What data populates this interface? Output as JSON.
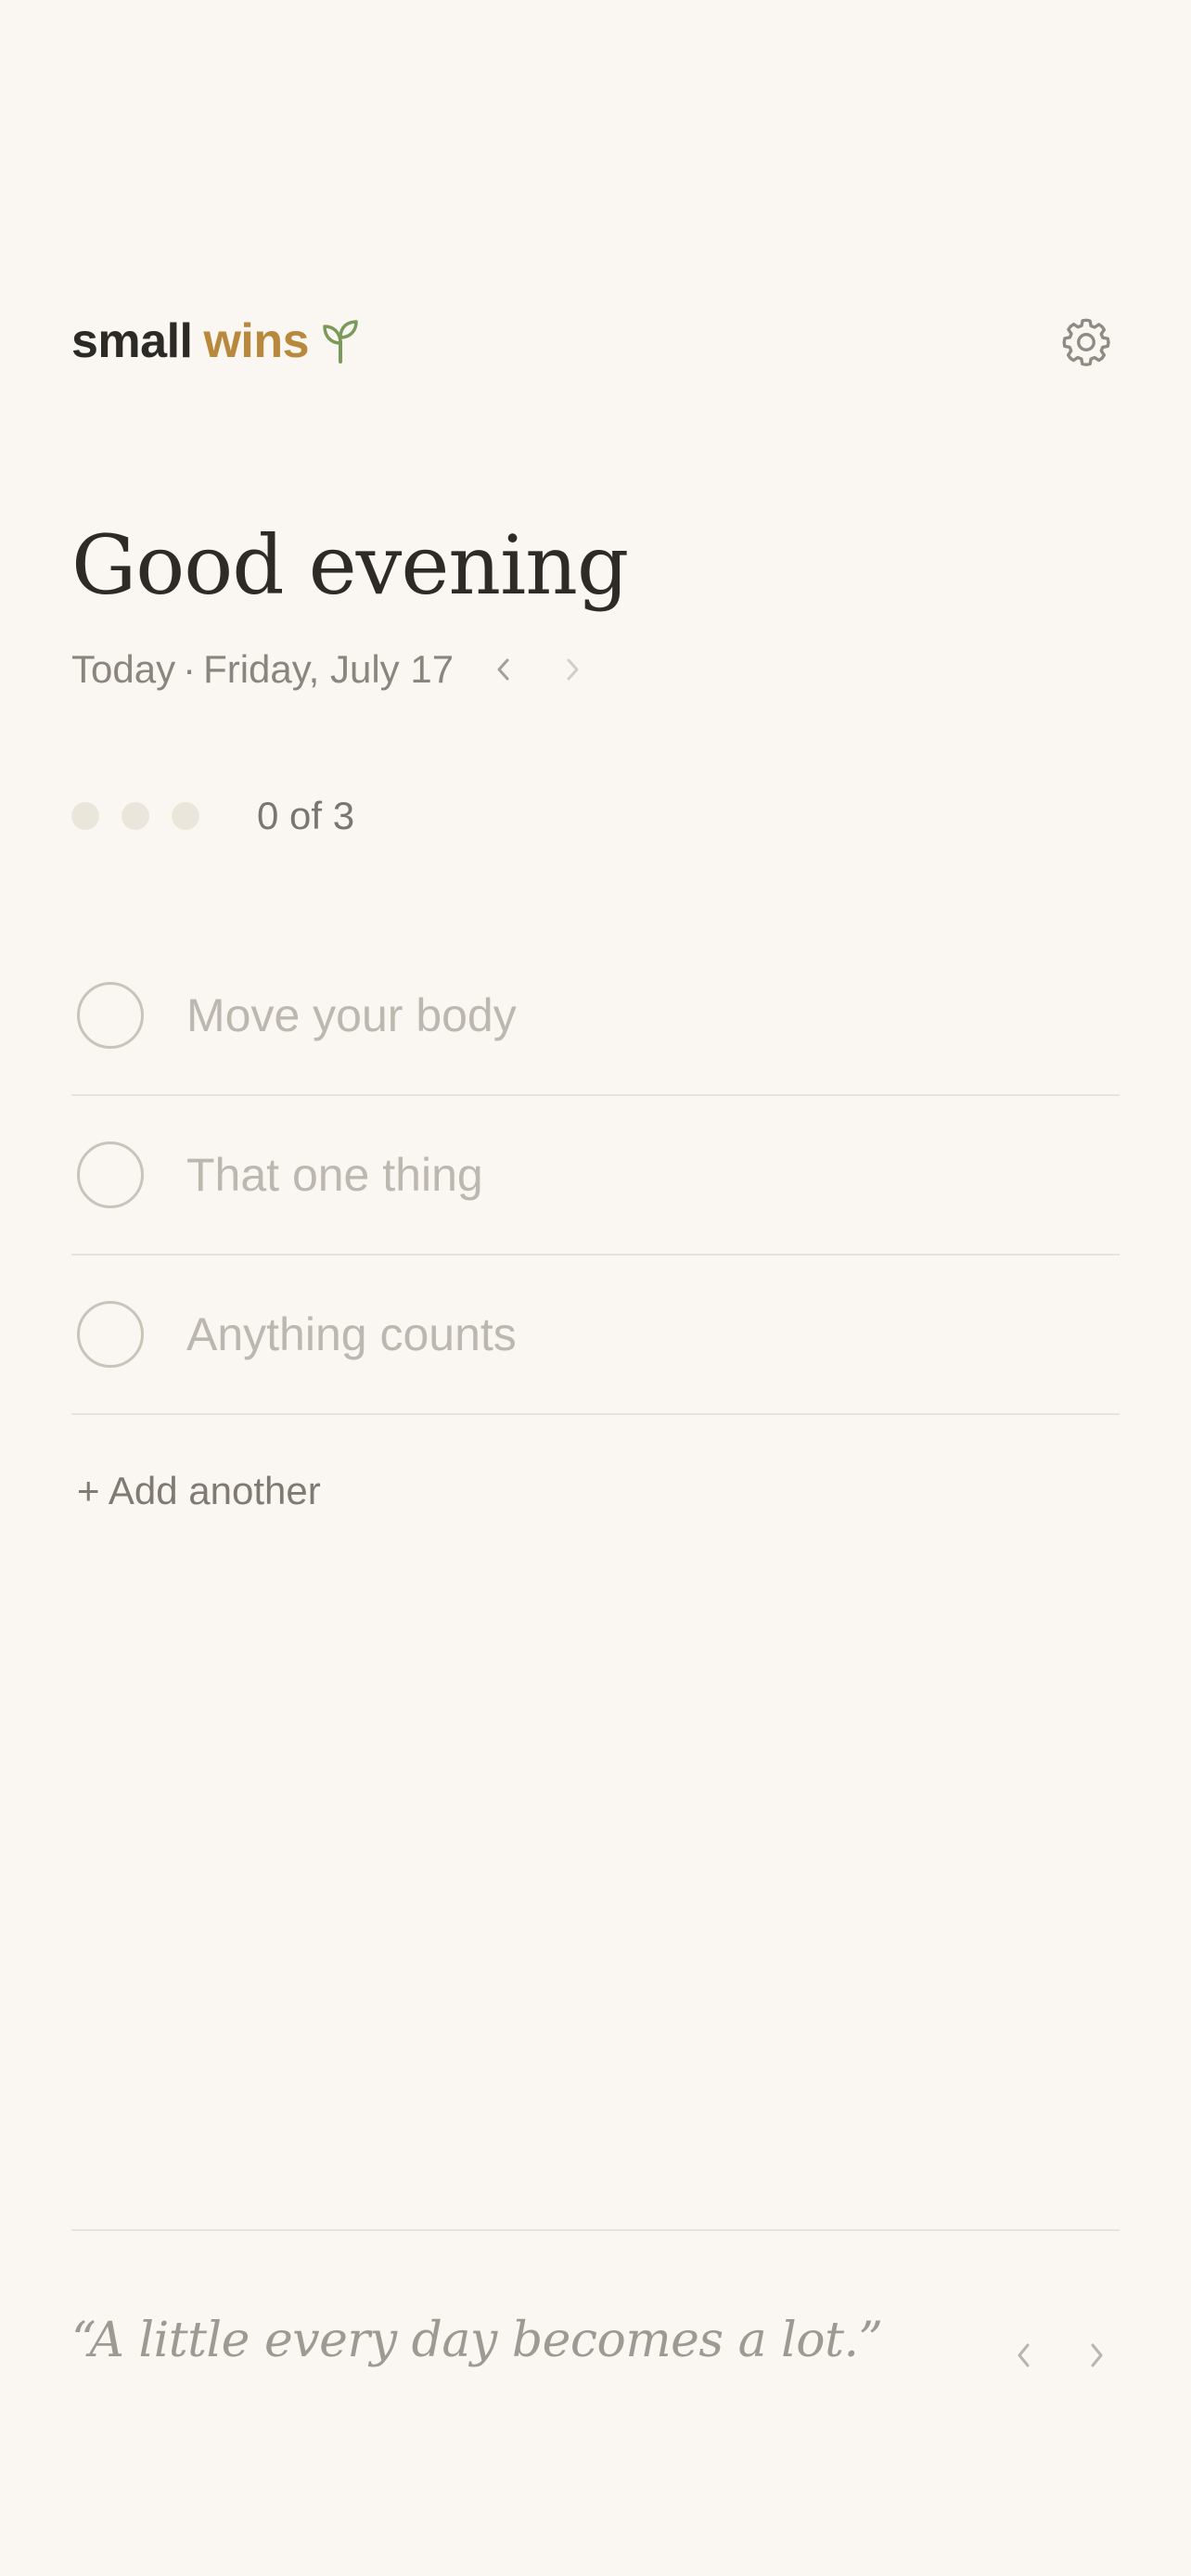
{
  "header": {
    "brand_part1": "small",
    "brand_part2": "wins",
    "brand_icon": "sprout-icon",
    "settings_icon": "gear-icon"
  },
  "greeting": "Good evening",
  "date": {
    "today_label": "Today",
    "separator": "·",
    "value": "Friday, July 17",
    "prev_icon": "chevron-left-icon",
    "next_icon": "chevron-right-icon"
  },
  "progress": {
    "completed": 0,
    "total": 3,
    "label": "0 of 3"
  },
  "items": [
    {
      "placeholder": "Move your body",
      "done": false
    },
    {
      "placeholder": "That one thing",
      "done": false
    },
    {
      "placeholder": "Anything counts",
      "done": false
    }
  ],
  "add_label": "+ Add another",
  "quote": {
    "text": "“A little every day becomes a lot.”",
    "prev_icon": "chevron-left-icon",
    "next_icon": "chevron-right-icon"
  },
  "colors": {
    "background": "#faf6f1",
    "accent_gold": "#b8893d",
    "accent_green": "#7a9a5c",
    "text_dark": "#2e2b27",
    "text_muted": "#8a857d",
    "divider": "#e7e2da"
  }
}
